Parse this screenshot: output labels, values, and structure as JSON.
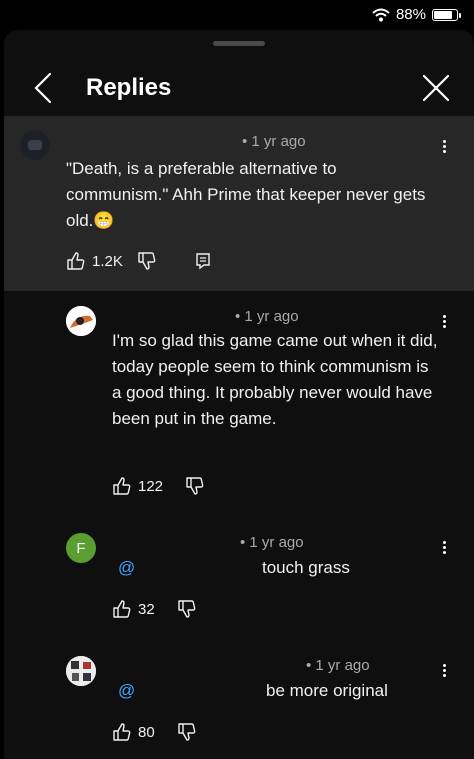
{
  "status": {
    "battery_text": "88%",
    "battery_level": 0.88
  },
  "header": {
    "title": "Replies"
  },
  "comments": [
    {
      "time": "• 1 yr ago",
      "text": "\"Death, is a preferable alternative to communism.\"  Ahh Prime that keeper never gets old.😁",
      "likes": "1.2K"
    },
    {
      "time": "• 1 yr ago",
      "text": "I'm so glad this game came out when it did, today people seem to think communism is a good thing. It probably never would have been put in the game.",
      "likes": "122"
    },
    {
      "time": "• 1 yr ago",
      "avatar_letter": "F",
      "avatar_color": "#5a9e32",
      "mention": "@",
      "text": "touch grass",
      "likes": "32"
    },
    {
      "time": "• 1 yr ago",
      "mention": "@",
      "text": "be more original",
      "likes": "80"
    }
  ]
}
